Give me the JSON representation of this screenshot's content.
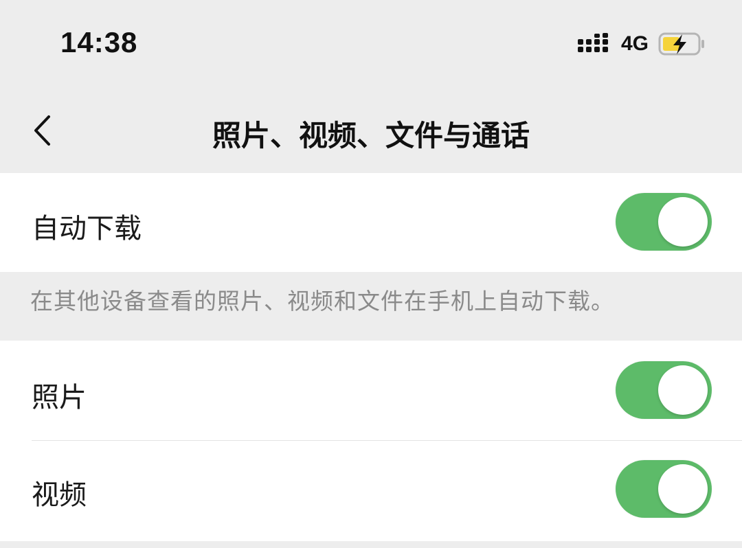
{
  "status_bar": {
    "time": "14:38",
    "network": "4G",
    "icons": [
      "signal-icon",
      "battery-charging-icon"
    ]
  },
  "nav": {
    "back_icon": "chevron-left-icon",
    "title": "照片、视频、文件与通话"
  },
  "settings": {
    "auto_download": {
      "label": "自动下载",
      "enabled": true
    },
    "hint": "在其他设备查看的照片、视频和文件在手机上自动下载。",
    "items": [
      {
        "label": "照片",
        "enabled": true
      },
      {
        "label": "视频",
        "enabled": true
      }
    ]
  },
  "colors": {
    "switch_on": "#5dbb69",
    "background": "#ededed",
    "cell": "#ffffff",
    "hint_text": "#8a8a8a",
    "battery_fill": "#f5d33b"
  }
}
